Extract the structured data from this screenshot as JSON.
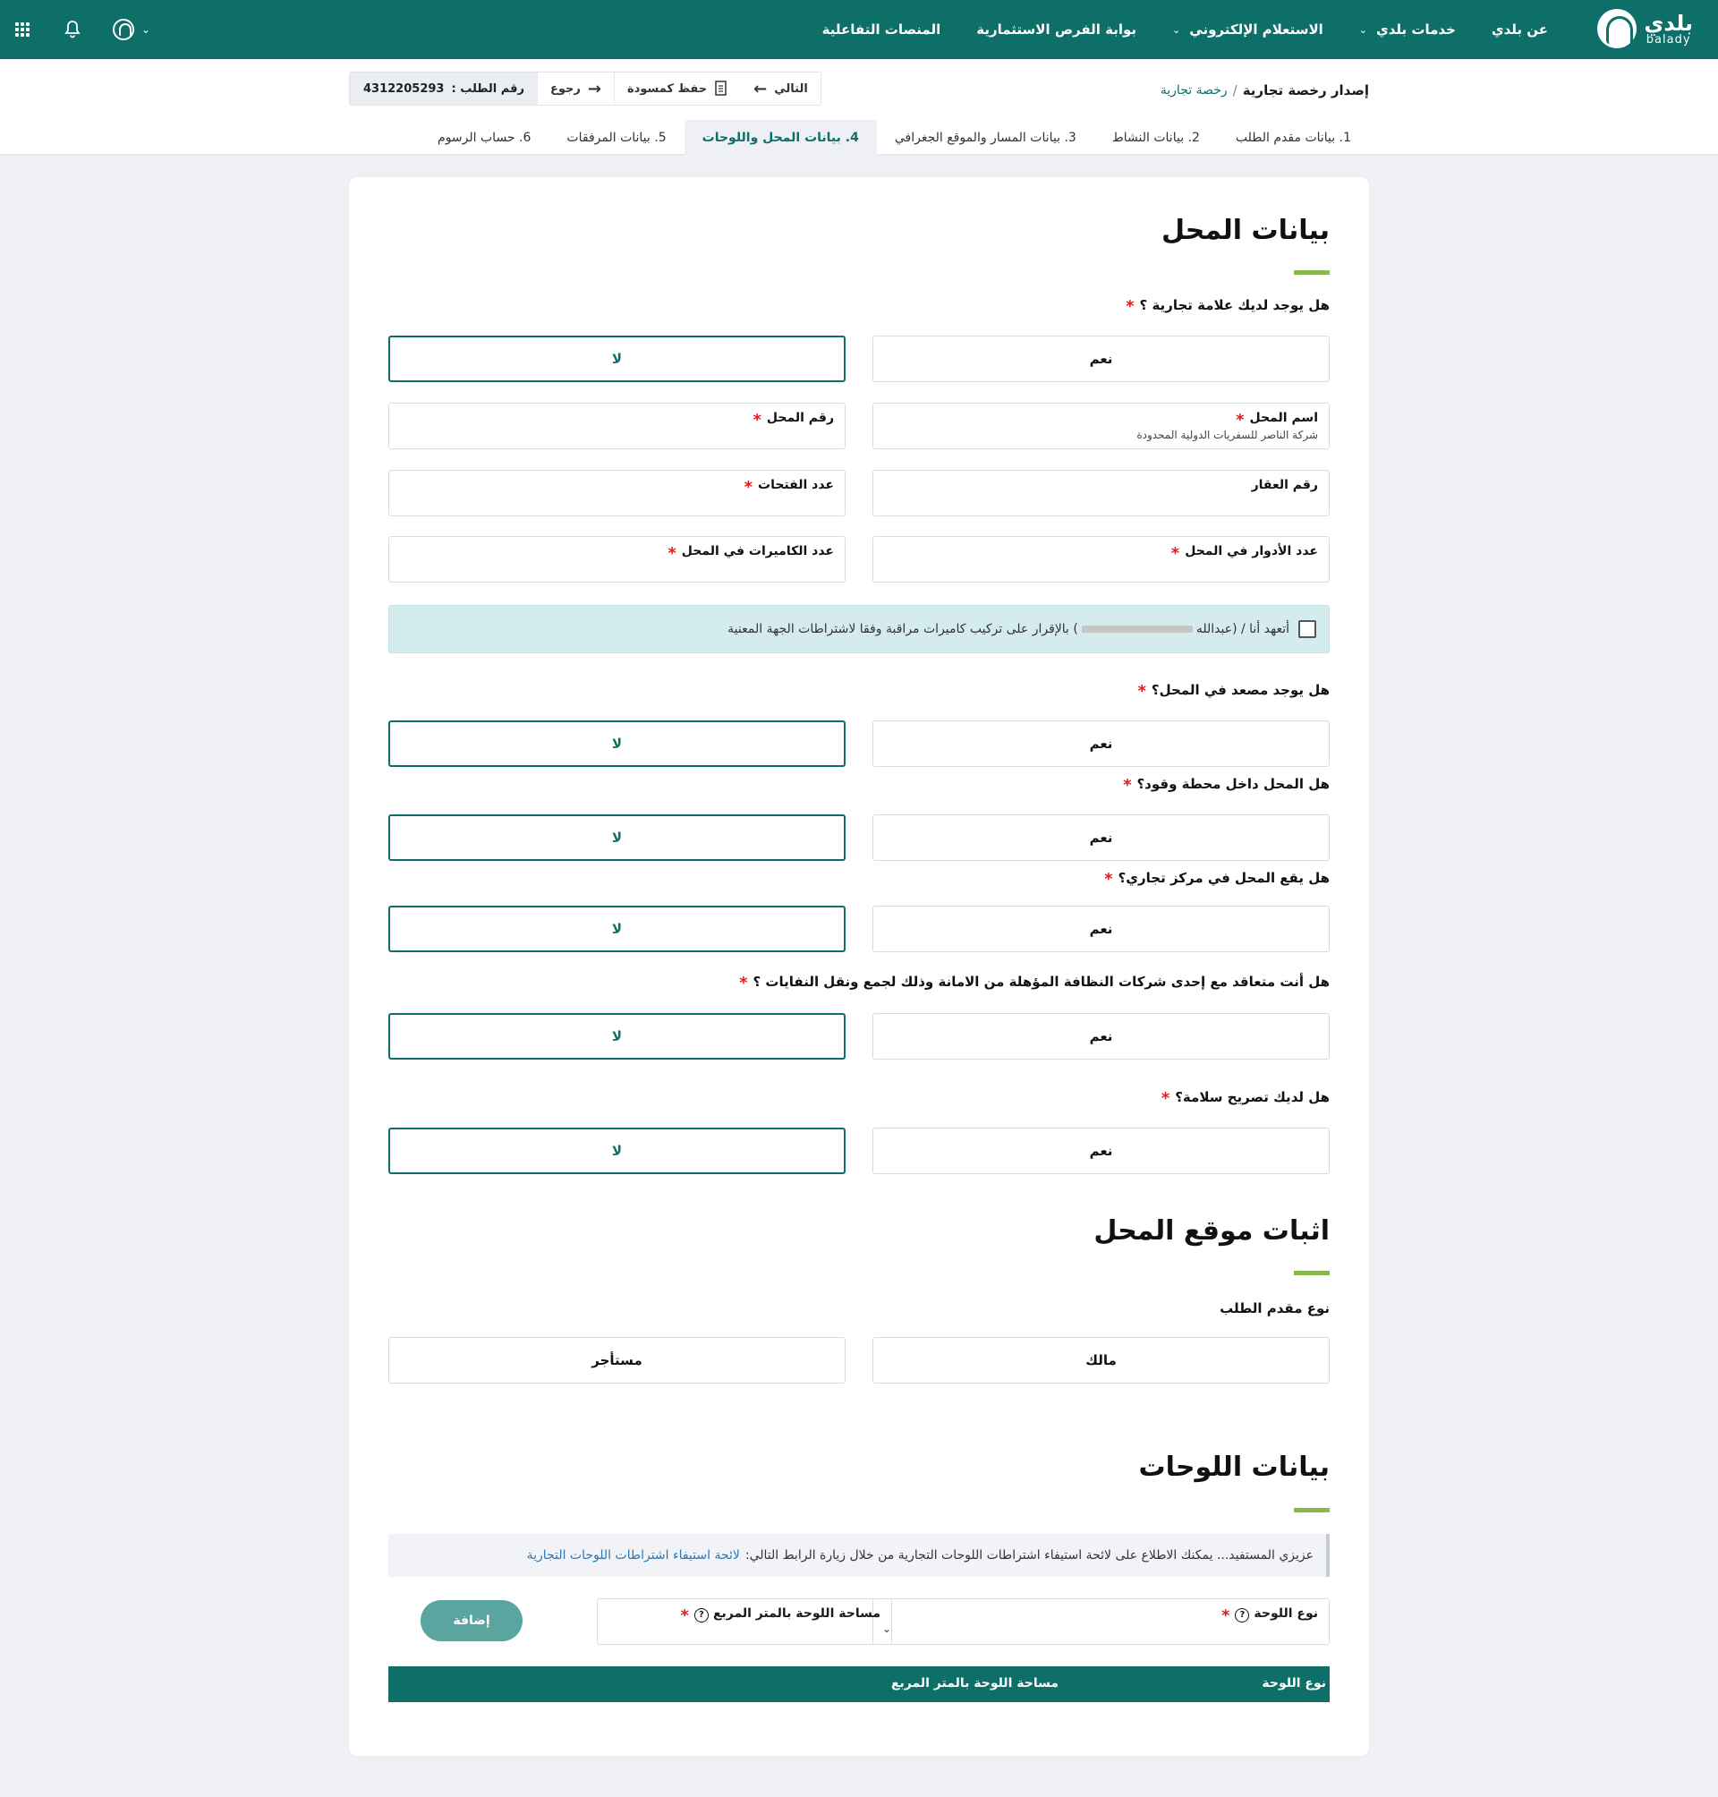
{
  "nav": {
    "brand_ar": "بلدي",
    "brand_en": "balady",
    "menu": [
      {
        "label": "عن بلدي",
        "has_dropdown": false
      },
      {
        "label": "خدمات بلدي",
        "has_dropdown": true
      },
      {
        "label": "الاستعلام الإلكتروني",
        "has_dropdown": true
      },
      {
        "label": "بوابة الفرص الاستثمارية",
        "has_dropdown": false
      },
      {
        "label": "المنصات التفاعلية",
        "has_dropdown": false
      }
    ],
    "icons": [
      "apps-grid-icon",
      "bell-icon",
      "user-avatar-icon",
      "chevron-down-icon"
    ]
  },
  "breadcrumb": {
    "current": "إصدار رخصة تجارية",
    "separator": "/",
    "parent": "رخصة تجارية"
  },
  "actions": {
    "request_label": "رقم الطلب :",
    "request_no": "4312205293",
    "back": "رجوع",
    "save_draft": "حفظ كمسودة",
    "next": "التالي"
  },
  "tabs": [
    {
      "num": "1.",
      "label": "بيانات مقدم الطلب",
      "active": false
    },
    {
      "num": "2.",
      "label": "بيانات النشاط",
      "active": false
    },
    {
      "num": "3.",
      "label": "بيانات المسار والموقع الجغرافي",
      "active": false
    },
    {
      "num": "4.",
      "label": "بيانات المحل واللوحات",
      "active": true
    },
    {
      "num": "5.",
      "label": "بيانات المرفقات",
      "active": false
    },
    {
      "num": "6.",
      "label": "حساب الرسوم",
      "active": false
    }
  ],
  "shop": {
    "title": "بيانات المحل",
    "q_trademark": "هل يوجد لديك علامة تجارية ؟",
    "yes": "نعم",
    "no": "لا",
    "fields": {
      "shop_name": {
        "label": "اسم المحل",
        "value": "شركة الناصر للسفريات الدولية المحدودة",
        "required": true
      },
      "shop_number": {
        "label": "رقم المحل",
        "value": "",
        "required": true
      },
      "property_number": {
        "label": "رقم العقار",
        "value": "",
        "required": false
      },
      "openings": {
        "label": "عدد الفتحات",
        "value": "",
        "required": true
      },
      "floors": {
        "label": "عدد الأدوار في المحل",
        "value": "",
        "required": true
      },
      "cameras": {
        "label": "عدد الكاميرات في المحل",
        "value": "",
        "required": true
      }
    },
    "pledge_pre": "أتعهد أنا / (عبدالله",
    "pledge_post": ") بالإقرار على تركيب كاميرات مراقبة وفقا لاشتراطات الجهة المعنية",
    "pledge_checked": false,
    "q_elevator": "هل يوجد مصعد في المحل؟",
    "q_fuel_station": "هل المحل داخل محطة وقود؟",
    "q_mall": "هل يقع المحل في مركز تجاري؟",
    "q_cleaning": "هل أنت متعاقد مع إحدى شركات النظافة المؤهلة من الامانة وذلك لجمع ونقل النفايات ؟",
    "q_safety": "هل لديك تصريح سلامة؟"
  },
  "location": {
    "title": "اثبات موقع المحل",
    "applicant_type_label": "نوع مقدم الطلب",
    "owner": "مالك",
    "tenant": "مستأجر"
  },
  "signs": {
    "title": "بيانات اللوحات",
    "info_text": "عزيزي المستفيد... يمكنك الاطلاع على لائحة استيفاء اشتراطات اللوحات التجارية من خلال زيارة الرابط التالي:",
    "info_link": "لائحة استيفاء اشتراطات اللوحات التجارية",
    "sign_type_label": "نوع اللوحة",
    "sign_area_label": "مساحة اللوحة بالمتر المربع",
    "add_button": "إضافة",
    "table_headers": [
      "نوع اللوحة",
      "مساحة اللوحة بالمتر المربع"
    ]
  },
  "colors": {
    "primary": "#0e6e68",
    "accent_bar": "#8ab84c",
    "required": "#e21b1b",
    "add_button": "#5aa5a0",
    "pledge_bg": "#d5ecef"
  }
}
